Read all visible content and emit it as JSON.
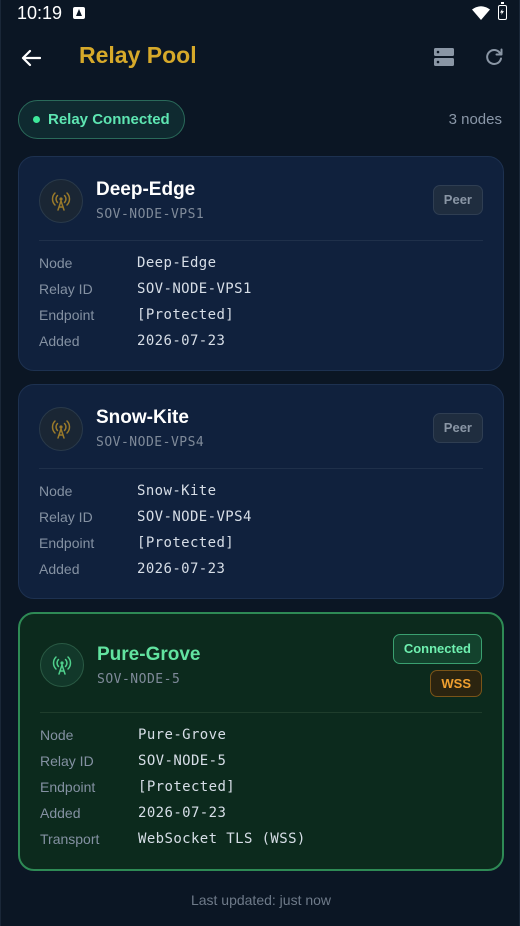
{
  "status_bar": {
    "time": "10:19"
  },
  "header": {
    "title": "Relay Pool"
  },
  "connection": {
    "label": "Relay Connected",
    "count": "3 nodes"
  },
  "detail_labels": {
    "node": "Node",
    "relay_id": "Relay ID",
    "endpoint": "Endpoint",
    "added": "Added",
    "transport": "Transport"
  },
  "nodes": [
    {
      "name": "Deep-Edge",
      "id": "SOV-NODE-VPS1",
      "badge": "Peer",
      "node": "Deep-Edge",
      "relay_id": "SOV-NODE-VPS1",
      "endpoint": "[Protected]",
      "added": "2026-07-23"
    },
    {
      "name": "Snow-Kite",
      "id": "SOV-NODE-VPS4",
      "badge": "Peer",
      "node": "Snow-Kite",
      "relay_id": "SOV-NODE-VPS4",
      "endpoint": "[Protected]",
      "added": "2026-07-23"
    },
    {
      "name": "Pure-Grove",
      "id": "SOV-NODE-5",
      "badge": "Connected",
      "transport_badge": "WSS",
      "node": "Pure-Grove",
      "relay_id": "SOV-NODE-5",
      "endpoint": "[Protected]",
      "added": "2026-07-23",
      "transport": "WebSocket TLS (WSS)"
    }
  ],
  "footer": {
    "text": "Last updated: just now"
  },
  "icons": {
    "back": "arrow-left-icon",
    "servers": "servers-icon",
    "refresh": "refresh-icon",
    "relay": "antenna-icon"
  },
  "colors": {
    "accent_gold": "#d6a92a",
    "connected_green": "#62e3a0",
    "wss_orange": "#f0a030"
  }
}
